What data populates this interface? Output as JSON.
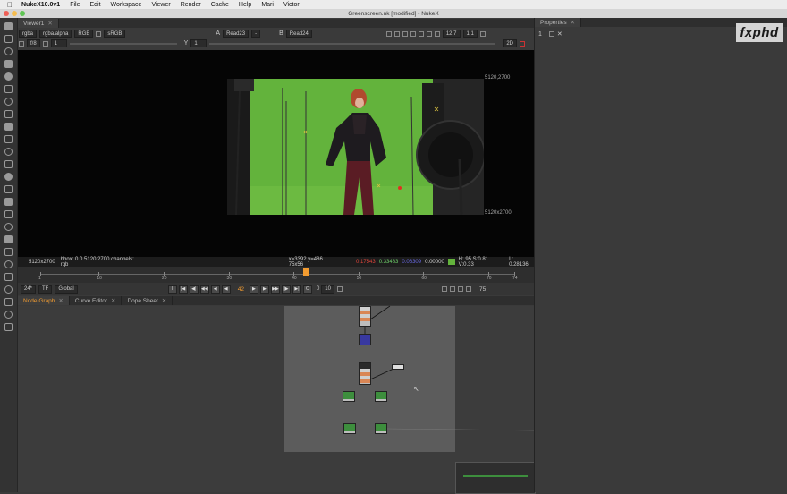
{
  "menubar": {
    "app": "NukeX10.0v1",
    "items": [
      "File",
      "Edit",
      "Workspace",
      "Viewer",
      "Render",
      "Cache",
      "Help",
      "Mari",
      "Victor"
    ]
  },
  "window": {
    "title": "Greenscreen.nk [modified] - NukeX"
  },
  "viewer": {
    "tab": "Viewer1",
    "row1": {
      "channels": "rgba",
      "alpha": "rgba.alpha",
      "rgb": "RGB",
      "colorspace": "sRGB",
      "input_a_label": "A",
      "input_a": "Read23",
      "dash": "-",
      "input_b_label": "B",
      "input_b": "Read24",
      "zoom": "12.7",
      "ratio": "1:1"
    },
    "row2": {
      "fstop": "f/8",
      "gain": "1",
      "y_label": "Y",
      "gamma": "1",
      "mode": "2D"
    },
    "format_top": "5120,2700",
    "format_bottom": "5120x2700",
    "info": {
      "format": "5120x2700",
      "bbox": "bbox: 0 0 5120 2700 channels: rgb",
      "coords": "x=3392 y=486 75x56",
      "r": "0.17543",
      "g": "0.33483",
      "b": "0.06309",
      "a": "0.00000",
      "hsv": "H: 95 S:0.81 V:0.33",
      "l": "L: 0.28136"
    }
  },
  "timeline": {
    "ticks": [
      "1",
      "10",
      "20",
      "30",
      "40",
      "50",
      "60",
      "70",
      "74"
    ],
    "fps": "24*",
    "tf": "TF",
    "scope": "Global",
    "frame": "42",
    "skip": "10",
    "skip_prefix": "0",
    "end_frame": "75",
    "current_frame_fraction": 0.56
  },
  "tabs": [
    "Node Graph",
    "Curve Editor",
    "Dope Sheet"
  ],
  "properties": {
    "tab": "Properties",
    "count": "1",
    "close": "✕"
  },
  "logo": "fxphd",
  "colors": {
    "accent": "#f39c30",
    "green_screen": "#63b33c",
    "r_value": "#e0443a",
    "g_value": "#6fd16a",
    "b_value": "#6a6ae6"
  }
}
